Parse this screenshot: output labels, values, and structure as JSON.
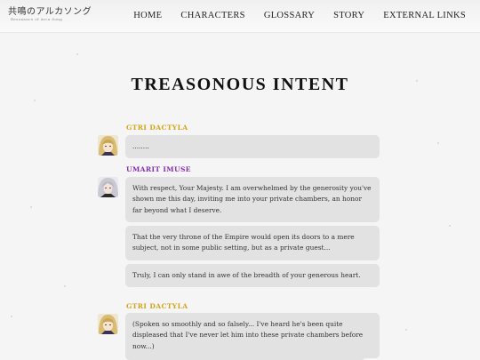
{
  "header": {
    "logo_title": "共鳴のアルカソング",
    "logo_subtitle": "Resonance of Arca Song",
    "nav": [
      "HOME",
      "CHARACTERS",
      "GLOSSARY",
      "STORY",
      "EXTERNAL LINKS"
    ]
  },
  "page": {
    "title": "TREASONOUS INTENT"
  },
  "dialogue": [
    {
      "speaker": "GTRI DACTYLA",
      "speaker_color": "#d4a419",
      "avatar": "blond-portrait",
      "lines": [
        "........"
      ]
    },
    {
      "speaker": "UMARIT IMUSE",
      "speaker_color": "#8a2db3",
      "avatar": "silver-haired-portrait",
      "lines": [
        "With respect, Your Majesty. I am overwhelmed by the generosity you've shown me this day, inviting me into your private chambers, an honor far beyond what I deserve.",
        "That the very throne of the Empire would open its doors to a mere subject, not in some public setting, but as a private guest...",
        "Truly, I can only stand in awe of the breadth of your generous heart."
      ]
    },
    {
      "speaker": "GTRI DACTYLA",
      "speaker_color": "#d4a419",
      "avatar": "blond-portrait",
      "lines": [
        "(Spoken so smoothly and so falsely... I've heard he's been quite displeased that I've never let him into these private chambers before now...)"
      ]
    }
  ]
}
